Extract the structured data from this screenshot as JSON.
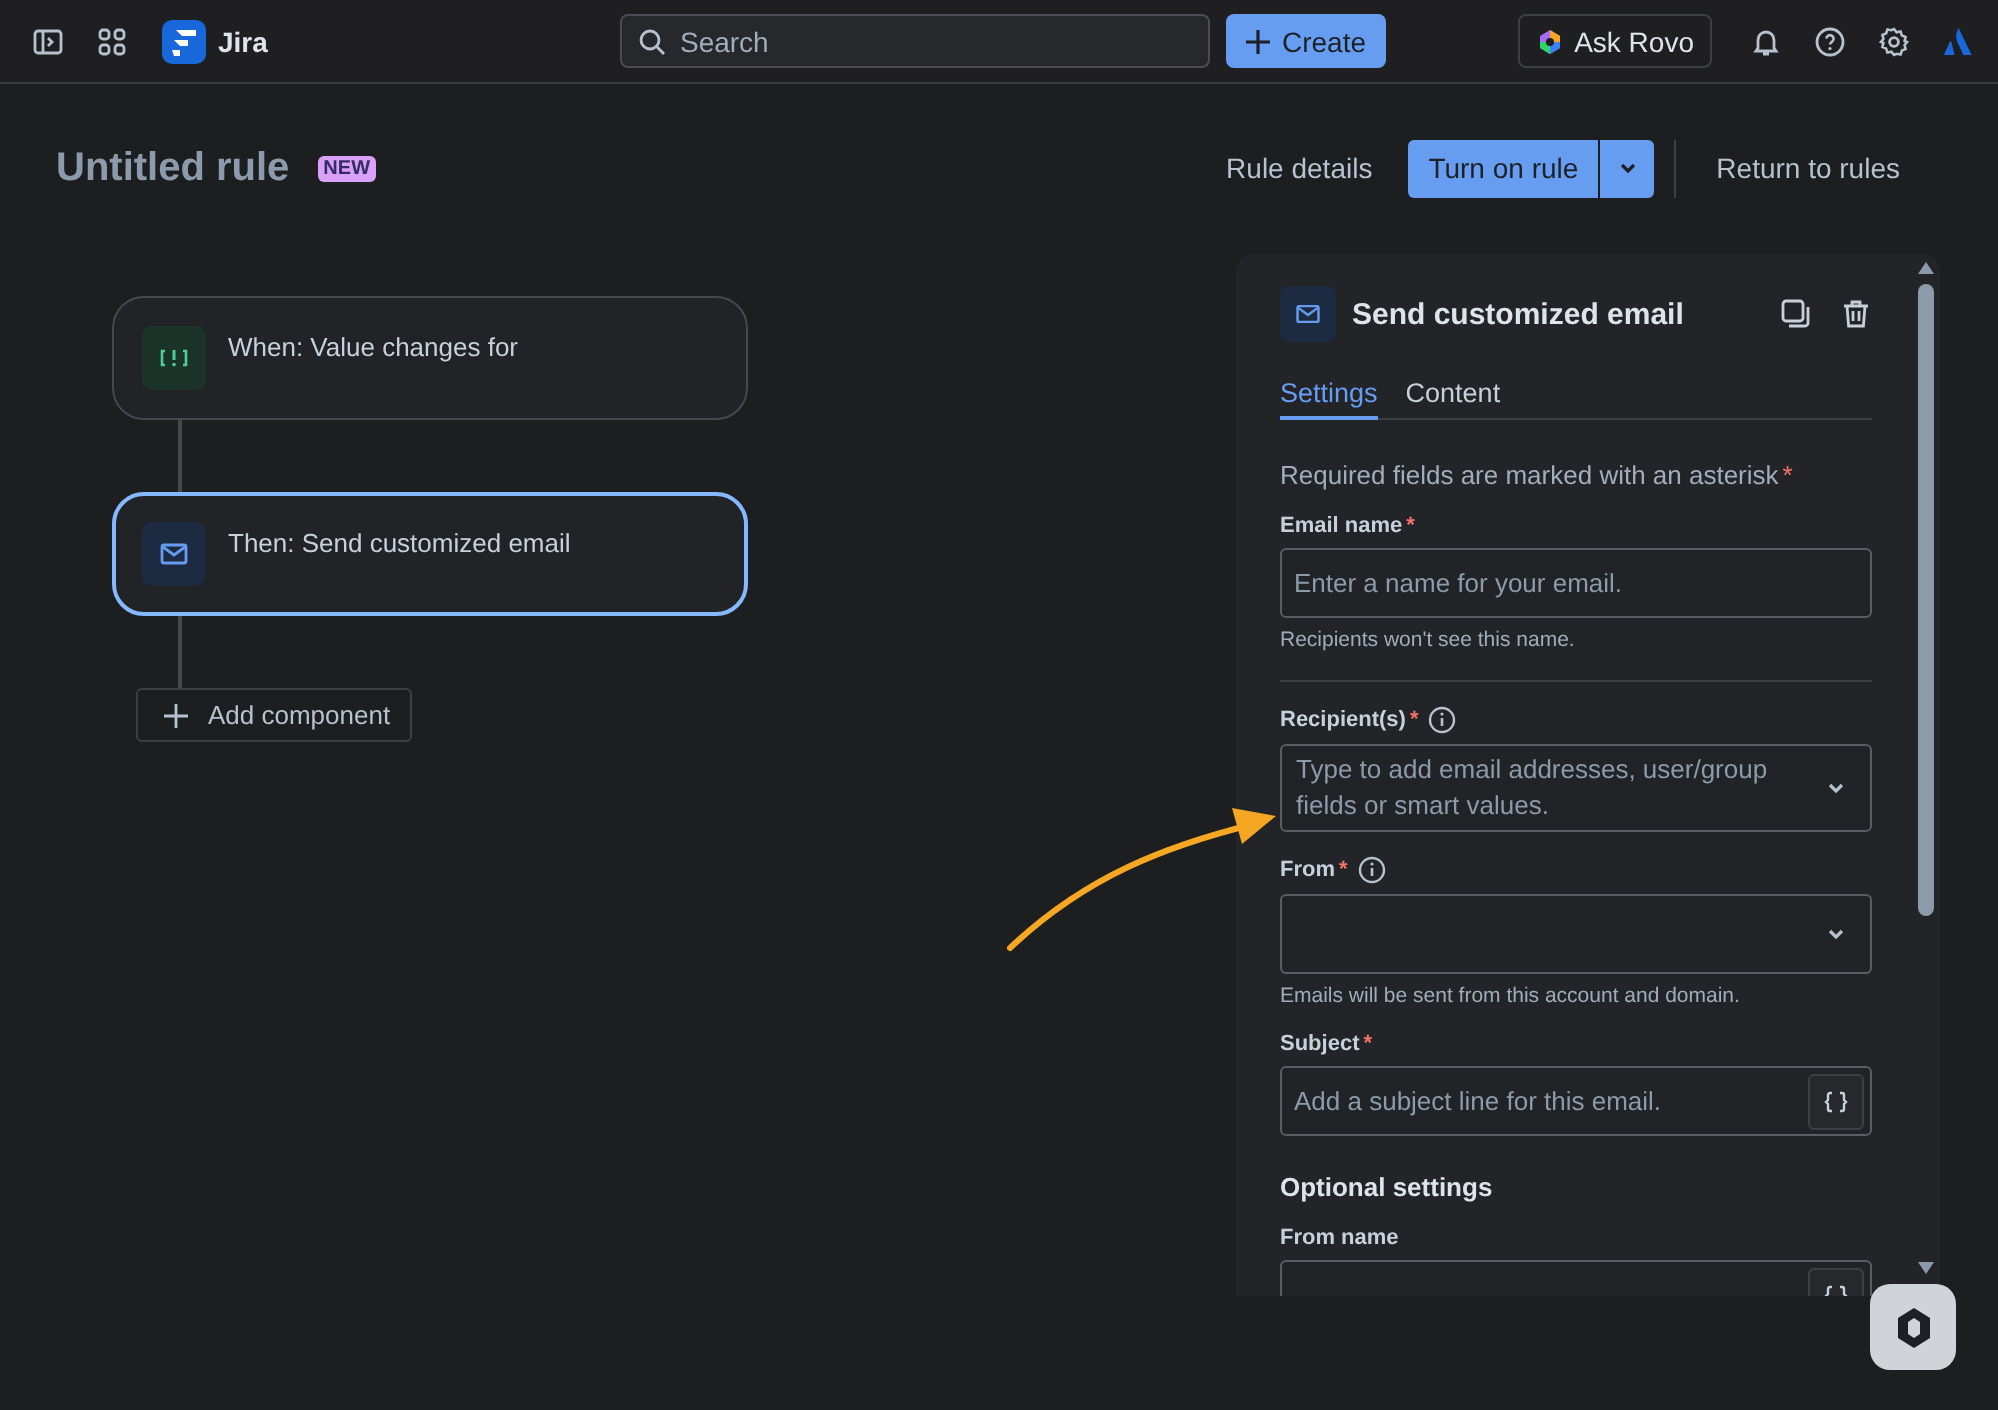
{
  "topbar": {
    "product": "Jira",
    "search": {
      "placeholder": "Search"
    },
    "create_button": "Create",
    "rovo_button": "Ask Rovo"
  },
  "header": {
    "title": "Untitled rule",
    "badge": "NEW",
    "details_button": "Rule details",
    "turn_on_button": "Turn on rule",
    "return_button": "Return to rules"
  },
  "flow": {
    "nodes": [
      {
        "kind": "trigger",
        "label": "When: Value changes for",
        "selected": false
      },
      {
        "kind": "action",
        "label": "Then: Send customized email",
        "selected": true
      }
    ],
    "add_button": "Add component"
  },
  "panel": {
    "title": "Send customized email",
    "required_mark": "*",
    "tabs": [
      {
        "label": "Settings",
        "selected": true
      },
      {
        "label": "Content",
        "selected": false
      }
    ],
    "required_note": "Required fields are marked with an asterisk",
    "items": [
      {
        "kind": "text",
        "label": "Email name",
        "required": true,
        "info": false,
        "placeholder": "Enter a name for your email.",
        "help": "Recipients won't see this name."
      },
      {
        "kind": "divider"
      },
      {
        "kind": "select",
        "label": "Recipient(s)",
        "required": true,
        "info": true,
        "placeholder": "Type to add email addresses, user/group fields or smart values."
      },
      {
        "kind": "select",
        "label": "From",
        "required": true,
        "info": true,
        "help": "Emails will be sent from this account and domain."
      },
      {
        "kind": "smart",
        "label": "Subject",
        "required": true,
        "info": false,
        "placeholder": "Add a subject line for this email."
      },
      {
        "kind": "heading",
        "label": "Optional settings"
      },
      {
        "kind": "smart",
        "label": "From name",
        "required": false,
        "info": false
      }
    ]
  }
}
